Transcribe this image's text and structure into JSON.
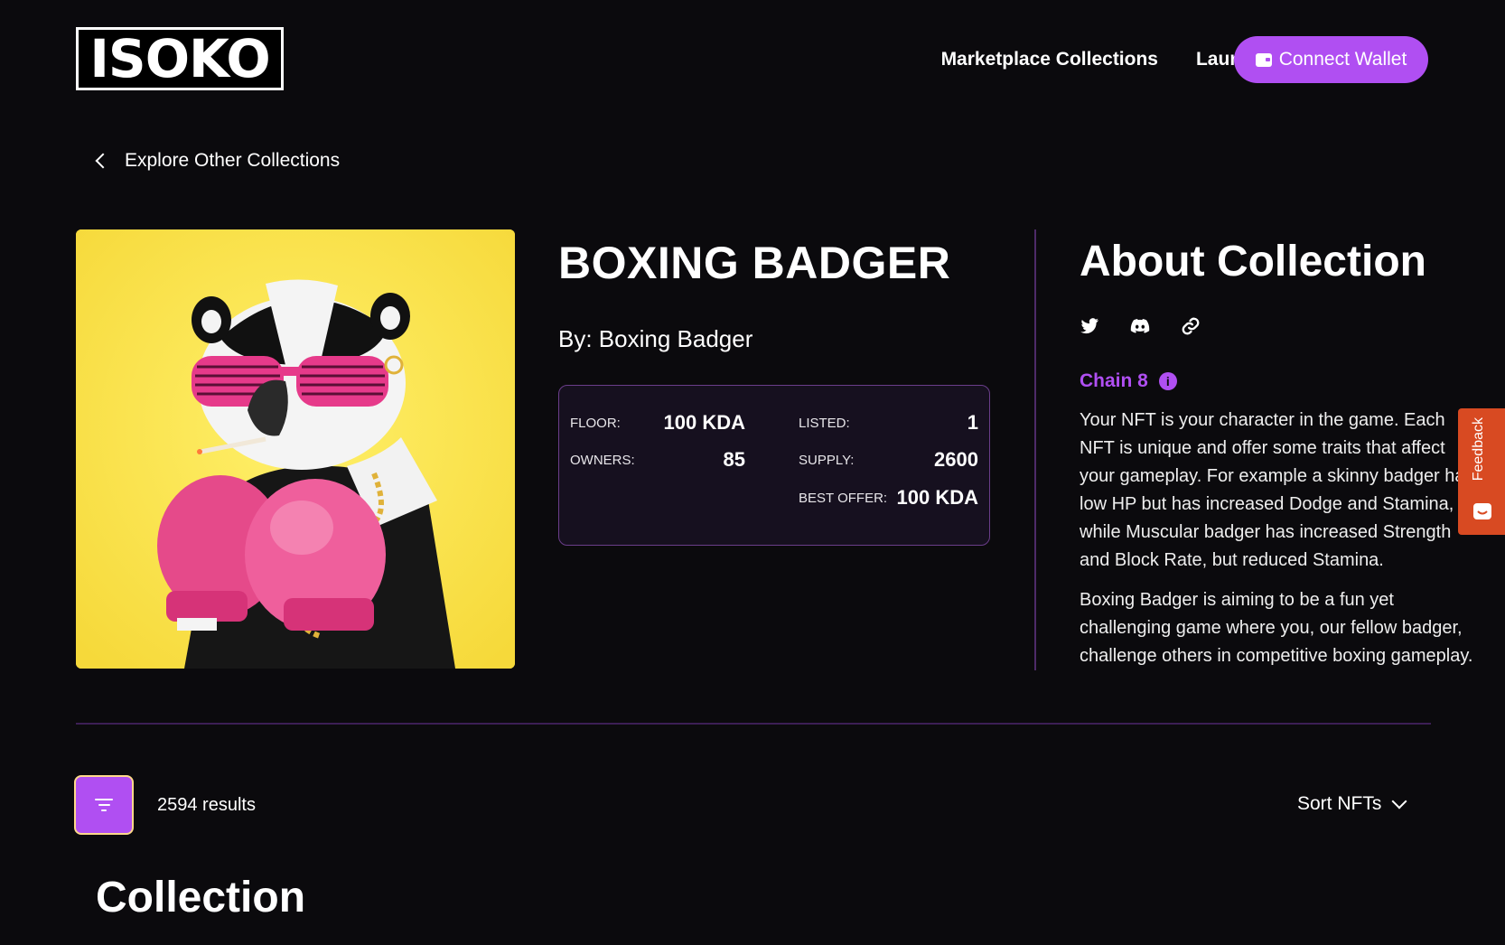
{
  "header": {
    "logo_text": "ISOKO",
    "nav": [
      "Marketplace Collections",
      "Launchpad"
    ],
    "connect_label": "Connect Wallet"
  },
  "back_link": "Explore Other Collections",
  "collection": {
    "title": "BOXING BADGER",
    "by": "By: Boxing Badger",
    "stats": {
      "floor_label": "FLOOR:",
      "floor_value": "100 KDA",
      "listed_label": "LISTED:",
      "listed_value": "1",
      "owners_label": "OWNERS:",
      "owners_value": "85",
      "supply_label": "SUPPLY:",
      "supply_value": "2600",
      "best_offer_label": "BEST OFFER:",
      "best_offer_value": "100 KDA"
    }
  },
  "about": {
    "title": "About Collection",
    "social_icons": [
      "twitter-icon",
      "discord-icon",
      "link-icon"
    ],
    "chain_label": "Chain 8",
    "paragraphs": [
      "Your NFT is your character in the game. Each NFT is unique and offer some traits that affect your gameplay. For example a skinny badger has low HP but has increased Dodge and Stamina, while Muscular badger has increased Strength and Block Rate, but reduced Stamina.",
      "Boxing Badger is aiming to be a fun yet challenging game where you, our fellow badger, challenge others in competitive boxing gameplay."
    ]
  },
  "feedback_label": "Feedback",
  "toolbar": {
    "results": "2594 results",
    "sort_label": "Sort NFTs"
  },
  "section_heading": "Collection",
  "colors": {
    "accent": "#b04ff2",
    "background": "#0b0a0d",
    "feedback": "#d84a22",
    "image_bg": "#ffe94a"
  }
}
